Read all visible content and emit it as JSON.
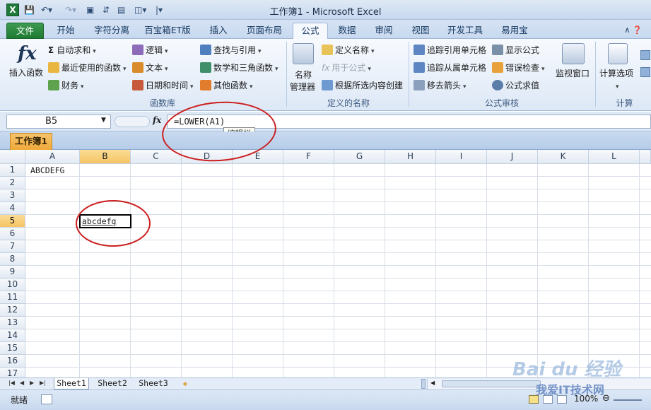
{
  "window": {
    "app_icon": "X",
    "title": "工作簿1 - Microsoft Excel"
  },
  "tabs": [
    "文件",
    "开始",
    "字符分离",
    "百宝箱ET版",
    "插入",
    "页面布局",
    "公式",
    "数据",
    "审阅",
    "视图",
    "开发工具",
    "易用宝"
  ],
  "active_tab": "公式",
  "ribbon": {
    "function_library": {
      "insert_function": "插入函数",
      "autosum": "自动求和",
      "recently_used": "最近使用的函数",
      "financial": "财务",
      "logical": "逻辑",
      "text": "文本",
      "date_time": "日期和时间",
      "lookup_reference": "查找与引用",
      "math_trig": "数学和三角函数",
      "more_functions": "其他函数",
      "group_label": "函数库"
    },
    "defined_names": {
      "name_manager_line1": "名称",
      "name_manager_line2": "管理器",
      "define_name": "定义名称",
      "use_in_formula": "用于公式",
      "create_from_selection": "根据所选内容创建",
      "group_label": "定义的名称"
    },
    "formula_auditing": {
      "trace_precedents": "追踪引用单元格",
      "trace_dependents": "追踪从属单元格",
      "remove_arrows": "移去箭头",
      "show_formulas": "显示公式",
      "error_checking": "错误检查",
      "evaluate_formula": "公式求值",
      "watch_window": "监视窗口",
      "group_label": "公式审核"
    },
    "calculation": {
      "calc_options": "计算选项",
      "group_label": "计算"
    }
  },
  "formula_bar": {
    "name_box": "B5",
    "fx_label": "fx",
    "formula": "=LOWER(A1)",
    "tooltip": "编辑栏"
  },
  "workbook_tab": "工作簿1",
  "grid": {
    "columns": [
      "A",
      "B",
      "C",
      "D",
      "E",
      "F",
      "G",
      "H",
      "I",
      "J",
      "K",
      "L"
    ],
    "rows": [
      "1",
      "2",
      "3",
      "4",
      "5",
      "6",
      "7",
      "8",
      "9",
      "10",
      "11",
      "12",
      "13",
      "14",
      "15",
      "16",
      "17"
    ],
    "selected_column": "B",
    "selected_row": "5",
    "cells": {
      "A1": "ABCDEFG",
      "B5": "abcdefg"
    }
  },
  "sheets": [
    "Sheet1",
    "Sheet2",
    "Sheet3"
  ],
  "active_sheet": "Sheet1",
  "status": {
    "ready": "就绪",
    "zoom": "100%"
  },
  "watermark": {
    "brand": "Bai du 经验",
    "site": "我爱IT技术网"
  },
  "colors": {
    "file_tab": "#1f7a33",
    "selected_header": "#f4c463",
    "annotation": "#cc1f1f",
    "workbook_tab": "#efa93b"
  }
}
